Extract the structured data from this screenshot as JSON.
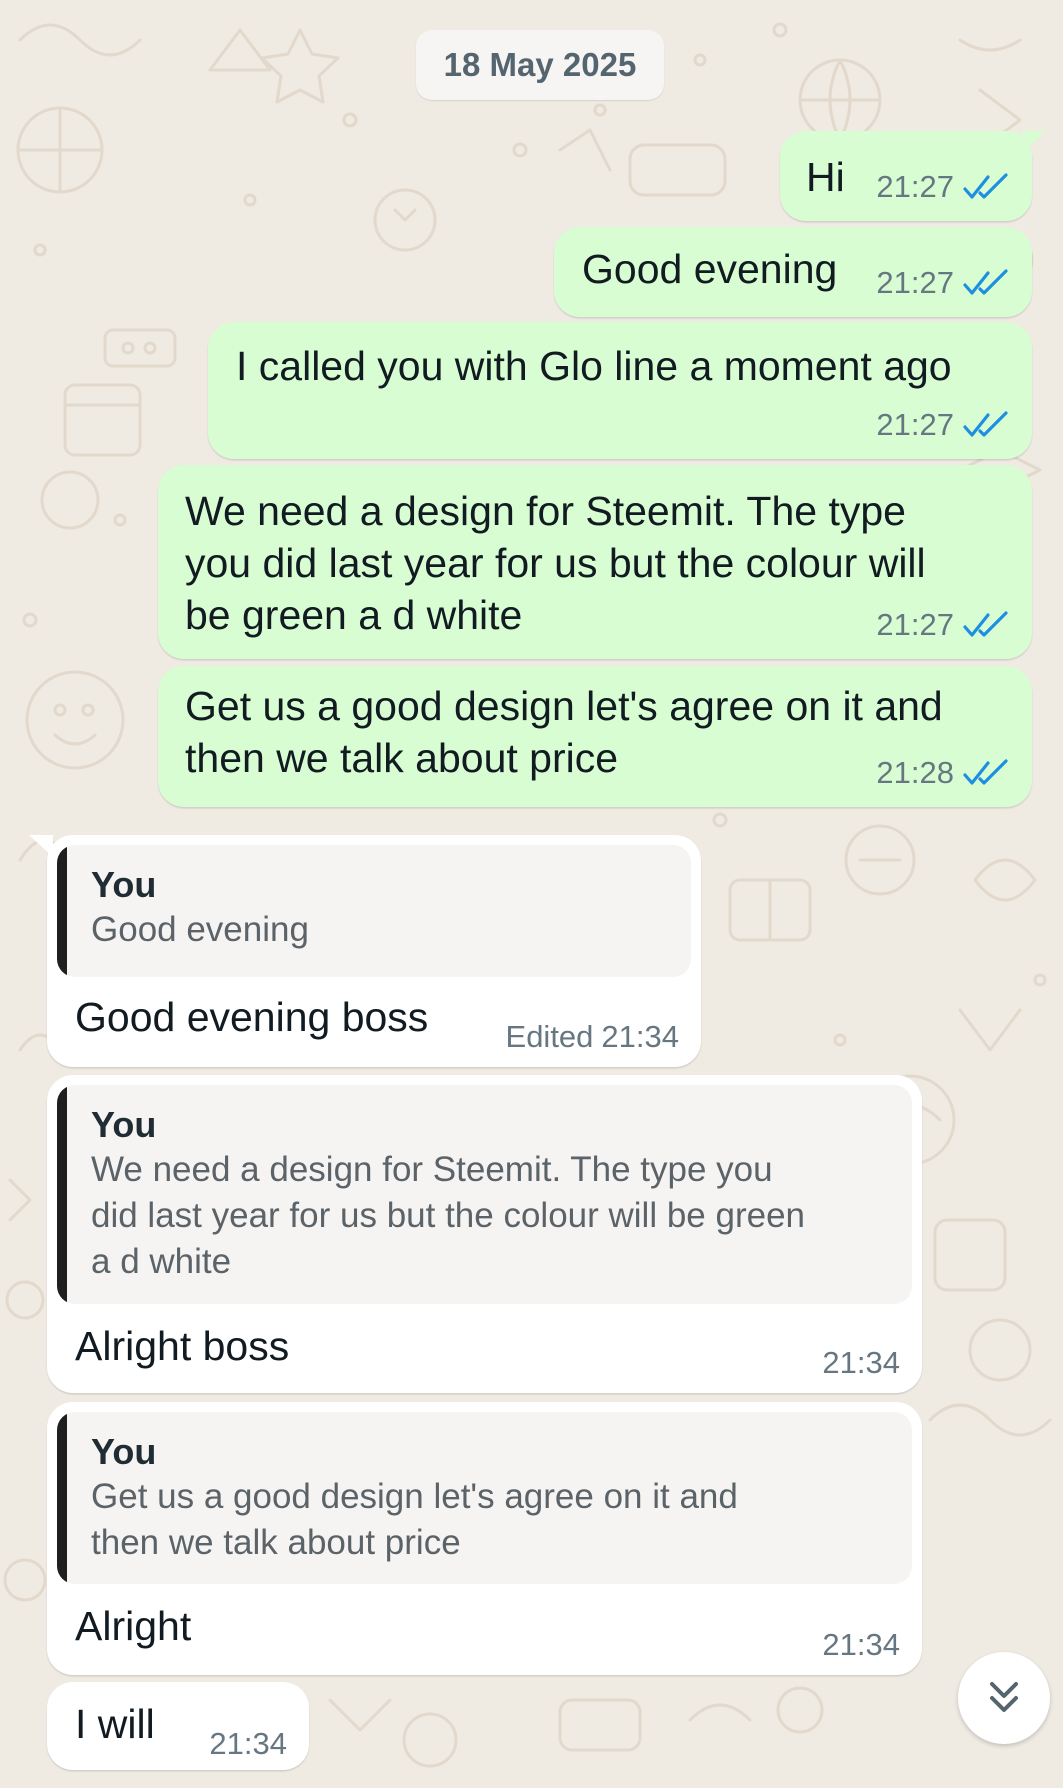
{
  "date_chip": "18 May 2025",
  "colors": {
    "wallpaper": "#efeae2",
    "outgoing_bubble": "#d9fdd3",
    "incoming_bubble": "#ffffff",
    "read_ticks": "#1d8fe0",
    "quote_bar": "#1f1f1f"
  },
  "messages": [
    {
      "direction": "outgoing",
      "text": "Hi",
      "time": "21:27",
      "status": "read"
    },
    {
      "direction": "outgoing",
      "text": "Good evening",
      "time": "21:27",
      "status": "read"
    },
    {
      "direction": "outgoing",
      "text": "I called you with Glo line a moment ago",
      "time": "21:27",
      "status": "read"
    },
    {
      "direction": "outgoing",
      "lines": [
        "We need a design for Steemit. The type",
        "you did last year for us but the colour will",
        "be green a d white"
      ],
      "time": "21:27",
      "status": "read"
    },
    {
      "direction": "outgoing",
      "lines": [
        "Get us a good design let's agree on it and",
        "then we talk about price"
      ],
      "time": "21:28",
      "status": "read"
    },
    {
      "direction": "incoming",
      "quote": {
        "author": "You",
        "lines": [
          "Good evening"
        ]
      },
      "text": "Good evening boss",
      "edited": "Edited",
      "time": "21:34"
    },
    {
      "direction": "incoming",
      "quote": {
        "author": "You",
        "lines": [
          "We need a design for Steemit. The type you",
          "did last year for us but the colour will be green",
          "a d white"
        ]
      },
      "text": "Alright boss",
      "time": "21:34"
    },
    {
      "direction": "incoming",
      "quote": {
        "author": "You",
        "lines": [
          "Get us a good design let's agree on it and",
          "then we talk about price"
        ]
      },
      "text": "Alright",
      "time": "21:34"
    },
    {
      "direction": "incoming",
      "text": "I will",
      "time": "21:34"
    }
  ],
  "icons": {
    "read_receipt": "double-check-icon",
    "scroll_down": "double-chevron-down-icon"
  }
}
